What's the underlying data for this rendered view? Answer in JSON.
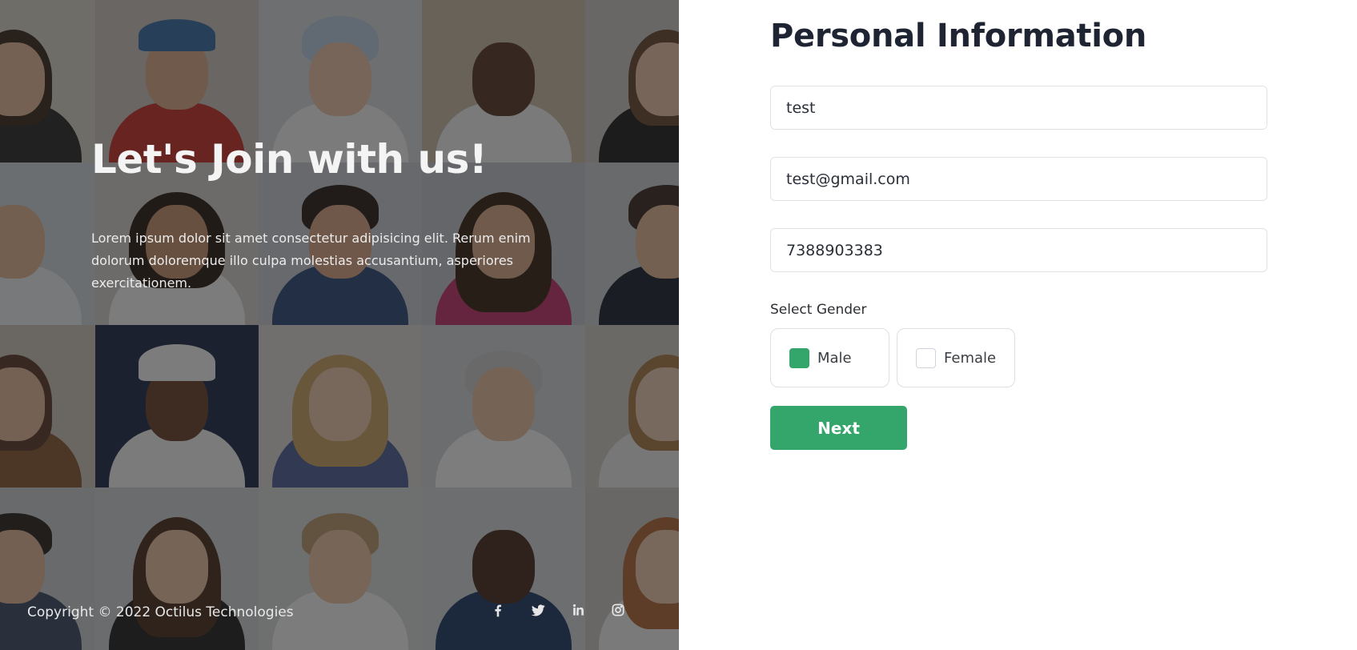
{
  "hero": {
    "title": "Let's Join with us!",
    "description": "Lorem ipsum dolor sit amet consectetur adipisicing elit. Rerum enim dolorum doloremque illo culpa molestias accusantium, asperiores exercitationem."
  },
  "footer": {
    "copyright": "Copyright © 2022 Octilus Technologies",
    "socials": [
      "facebook-icon",
      "twitter-icon",
      "linkedin-icon",
      "instagram-icon"
    ]
  },
  "form": {
    "title": "Personal Information",
    "name_value": "test",
    "email_value": "test@gmail.com",
    "phone_value": "7388903383",
    "gender_label": "Select Gender",
    "gender_options": [
      {
        "label": "Male",
        "selected": true
      },
      {
        "label": "Female",
        "selected": false
      }
    ],
    "next_label": "Next"
  },
  "colors": {
    "accent": "#35a66b",
    "title": "#1f2433",
    "overlay": "#1a1a1a"
  }
}
